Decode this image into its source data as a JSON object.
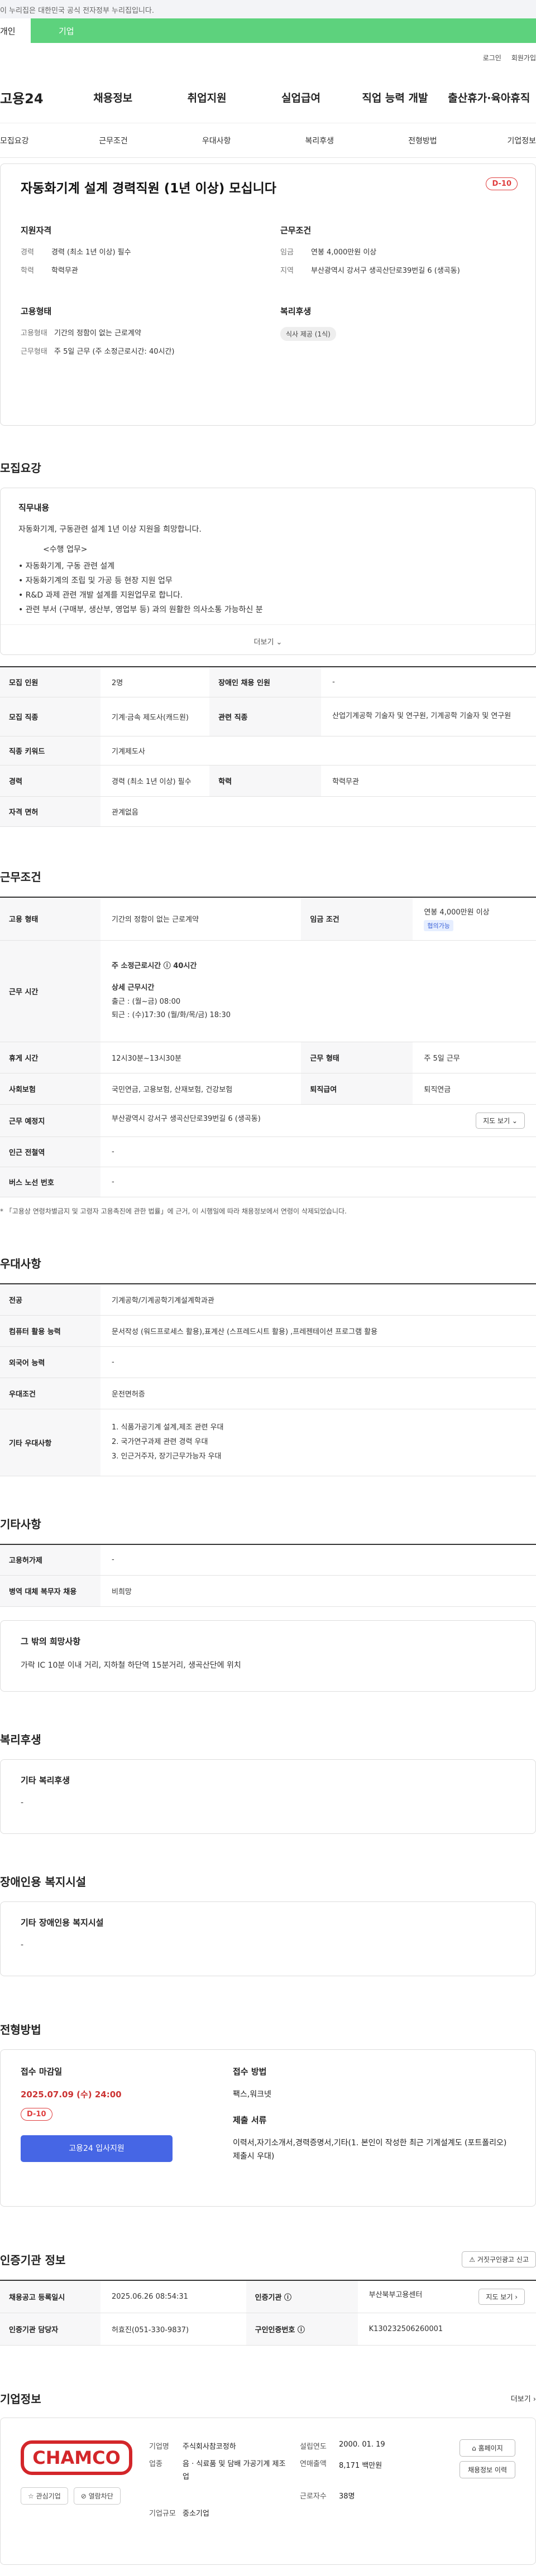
{
  "gov_banner": "이 누리집은 대한민국 공식 전자정부 누리집입니다.",
  "tabs": [
    "개인",
    "기업"
  ],
  "util": [
    "로그인",
    "회원가입"
  ],
  "logo": "고용24",
  "gnb": [
    "채용정보",
    "취업지원",
    "실업급여",
    "직업 능력 개발",
    "출산휴가·육아휴직"
  ],
  "anchors": [
    "모집요강",
    "근무조건",
    "우대사항",
    "복리후생",
    "전형방법",
    "기업정보"
  ],
  "summary": {
    "title": "자동화기계 설계 경력직원 (1년 이상) 모십니다",
    "dday": "D-10",
    "qual_h": "지원자격",
    "career_k": "경력",
    "career_v": "경력 (최소 1년 이상) 필수",
    "edu_k": "학력",
    "edu_v": "학력무관",
    "work_h": "근무조건",
    "wage_k": "임금",
    "wage_v": "연봉 4,000만원 이상",
    "region_k": "지역",
    "region_v": "부산광역시 강서구 생곡산단로39번길 6 (생곡동)",
    "emp_h": "고용형태",
    "emptype_k": "고용형태",
    "emptype_v": "기간의 정함이 없는 근로계약",
    "worktype_k": "근무형태",
    "worktype_v": "주 5일 근무 (주 소정근로시간: 40시간)",
    "welfare_h": "복리후생",
    "welfare_tag": "식사 제공 (1식)"
  },
  "recruit": {
    "title": "모집요강",
    "duty_h": "직무내용",
    "duty_p": "자동화기계, 구동관련 설계 1년 이상 지원을 희망합니다.",
    "task_h": "<수행 업무>",
    "tasks": [
      "• 자동화기계, 구동 관련 설계",
      "• 자동화기계의 조립 및 가공 등 현장 지원 업무",
      "• R&D 과제 관련 개발 설계를 지원업무로 합니다.",
      "• 관련 부서 (구매부, 생산부, 영업부 등) 과의 원활한 의사소통 가능하신 분"
    ],
    "more": "더보기 ⌄",
    "rows": {
      "people_k": "모집 인원",
      "people_v": "2명",
      "disabled_k": "장애인 채용 인원",
      "disabled_v": "-",
      "job_k": "모집 직종",
      "job_v": "기계·금속 제도사(캐드원)",
      "rel_k": "관련 직종",
      "rel_v": "산업기계공학 기술자 및 연구원, 기계공학 기술자 및 연구원",
      "kw_k": "직종 키워드",
      "kw_v": "기계제도사",
      "career_k": "경력",
      "career_v": "경력 (최소 1년 이상) 필수",
      "edu_k": "학력",
      "edu_v": "학력무관",
      "license_k": "자격 면허",
      "license_v": "관계없음"
    }
  },
  "conditions": {
    "title": "근무조건",
    "emptype_k": "고용 형태",
    "emptype_v": "기간의 정함이 없는 근로계약",
    "wage_k": "임금 조건",
    "wage_v": "연봉 4,000만원 이상",
    "wage_badge": "협의가능",
    "hours_k": "근무 시간",
    "hours_total": "주 소정근로시간 ⓘ 40시간",
    "hours_detail_h": "상세 근무시간",
    "hours_in": "출근 : (월~금) 08:00",
    "hours_out": "퇴근 : (수)17:30 (월/화/목/금) 18:30",
    "break_k": "휴게 시간",
    "break_v": "12시30분~13시30분",
    "form_k": "근무 형태",
    "form_v": "주 5일 근무",
    "ins_k": "사회보험",
    "ins_v": "국민연금, 고용보험, 산재보험, 건강보험",
    "retire_k": "퇴직급여",
    "retire_v": "퇴직연금",
    "place_k": "근무 예정지",
    "place_v": "부산광역시 강서구 생곡산단로39번길 6 (생곡동)",
    "map_btn": "지도 보기 ⌄",
    "station_k": "인근 전철역",
    "station_v": "-",
    "bus_k": "버스 노선 번호",
    "bus_v": "-",
    "note": "* 「고용상 연령차별금지 및 고령자 고용촉진에 관한 법률」에 근거, 이 시행일에 따라 채용정보에서 연령이 삭제되었습니다."
  },
  "preference": {
    "title": "우대사항",
    "major_k": "전공",
    "major_v": "기계공학/기계공학기계설계학과관",
    "pc_k": "컴퓨터 활용 능력",
    "pc_v": "문서작성 (워드프로세스 활용),표계산 (스프레드시트 활용) ,프레젠테이션 프로그램 활용",
    "lang_k": "외국어 능력",
    "lang_v": "-",
    "cond_k": "우대조건",
    "cond_v": "운전면허증",
    "etc_k": "기타 우대사항",
    "etc": [
      "1. 식품가공기계 설계,제조 관련 우대",
      "2. 국가연구과제 관련 경력 우대",
      "3. 인근거주자, 장기근무가능자 우대"
    ]
  },
  "other": {
    "title": "기타사항",
    "device_k": "고용허가제",
    "device_v": "-",
    "military_k": "병역 대체 복무자 채용",
    "military_v": "비희망",
    "box_h": "그 밖의 희망사항",
    "box_p": "가락 IC 10분 이내 거리, 지하철 하단역 15분거리, 생곡산단에 위치"
  },
  "welfare": {
    "title": "복리후생",
    "box_h": "기타 복리후생",
    "box_p": "-"
  },
  "disabled": {
    "title": "장애인용 복지시설",
    "box_h": "기타 장애인용 복지시설",
    "box_p": "-"
  },
  "process": {
    "title": "전형방법",
    "deadline_h": "접수 마감일",
    "deadline_v": "2025.07.09 (수) 24:00",
    "dday": "D-10",
    "apply_btn": "고용24 입사지원",
    "method_h": "접수 방법",
    "method_v": "팩스,워크넷",
    "docs_h": "제출 서류",
    "docs_v": "이력서,자기소개서,경력증명서,기타(1. 본인이 작성한 최근 기계설계도 (포트폴리오) 제출시 우대)"
  },
  "agency": {
    "title": "인증기관 정보",
    "report_btn": "⚠ 거짓구인광고 신고",
    "reg_k": "채용공고 등록일시",
    "reg_v": "2025.06.26 08:54:31",
    "org_k": "인증기관 ⓘ",
    "org_v": "부산북부고용센터",
    "map_btn": "지도 보기 ›",
    "staff_k": "인증기관 담당자",
    "staff_v": "허효진(051-330-9837)",
    "no_k": "구인인증번호 ⓘ",
    "no_v": "K130232506260001"
  },
  "company": {
    "title": "기업정보",
    "more": "더보기 ›",
    "logo_text": "CHAMCO",
    "fav_btn": "☆ 관심기업",
    "block_btn": "⊘ 열람차단",
    "name_k": "기업명",
    "name_v": "주식회사참코정하",
    "found_k": "설립연도",
    "found_v": "2000. 01. 19",
    "ind_k": "업종",
    "ind_v": "음 · 식료품 및 담배 가공기계 제조업",
    "rev_k": "연매출액",
    "rev_v": "8,171 백만원",
    "emp_k": "근로자수",
    "emp_v": "38명",
    "size_k": "기업규모",
    "size_v": "중소기업",
    "home_btn": "⌂ 홈페이지",
    "list_btn": "채용정보 이력"
  }
}
